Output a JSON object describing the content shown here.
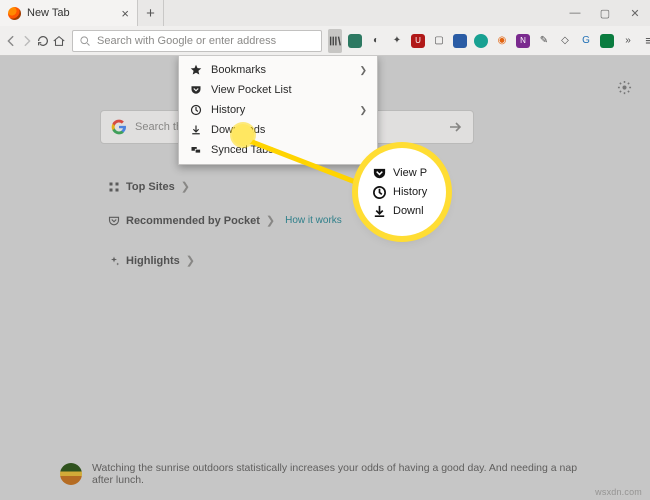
{
  "titlebar": {
    "tab": {
      "title": "New Tab"
    }
  },
  "toolbar": {
    "url_placeholder": "Search with Google or enter address"
  },
  "menu": {
    "items": [
      {
        "label": "Bookmarks",
        "icon": "star",
        "sub": true
      },
      {
        "label": "View Pocket List",
        "icon": "pocket",
        "sub": false
      },
      {
        "label": "History",
        "icon": "clock",
        "sub": true
      },
      {
        "label": "Downloads",
        "icon": "download",
        "sub": false
      },
      {
        "label": "Synced Tabs",
        "icon": "sync",
        "sub": false
      }
    ]
  },
  "page": {
    "search_placeholder": "Search the Web",
    "topsites_label": "Top Sites",
    "recommended_label": "Recommended by Pocket",
    "howitworks": "How it works",
    "highlights_label": "Highlights",
    "tip": "Watching the sunrise outdoors statistically increases your odds of having a good day. And needing a nap after lunch."
  },
  "magnifier": {
    "row0": "View P",
    "row1": "History",
    "row2": "Downl"
  },
  "watermark": "wsxdn.com"
}
